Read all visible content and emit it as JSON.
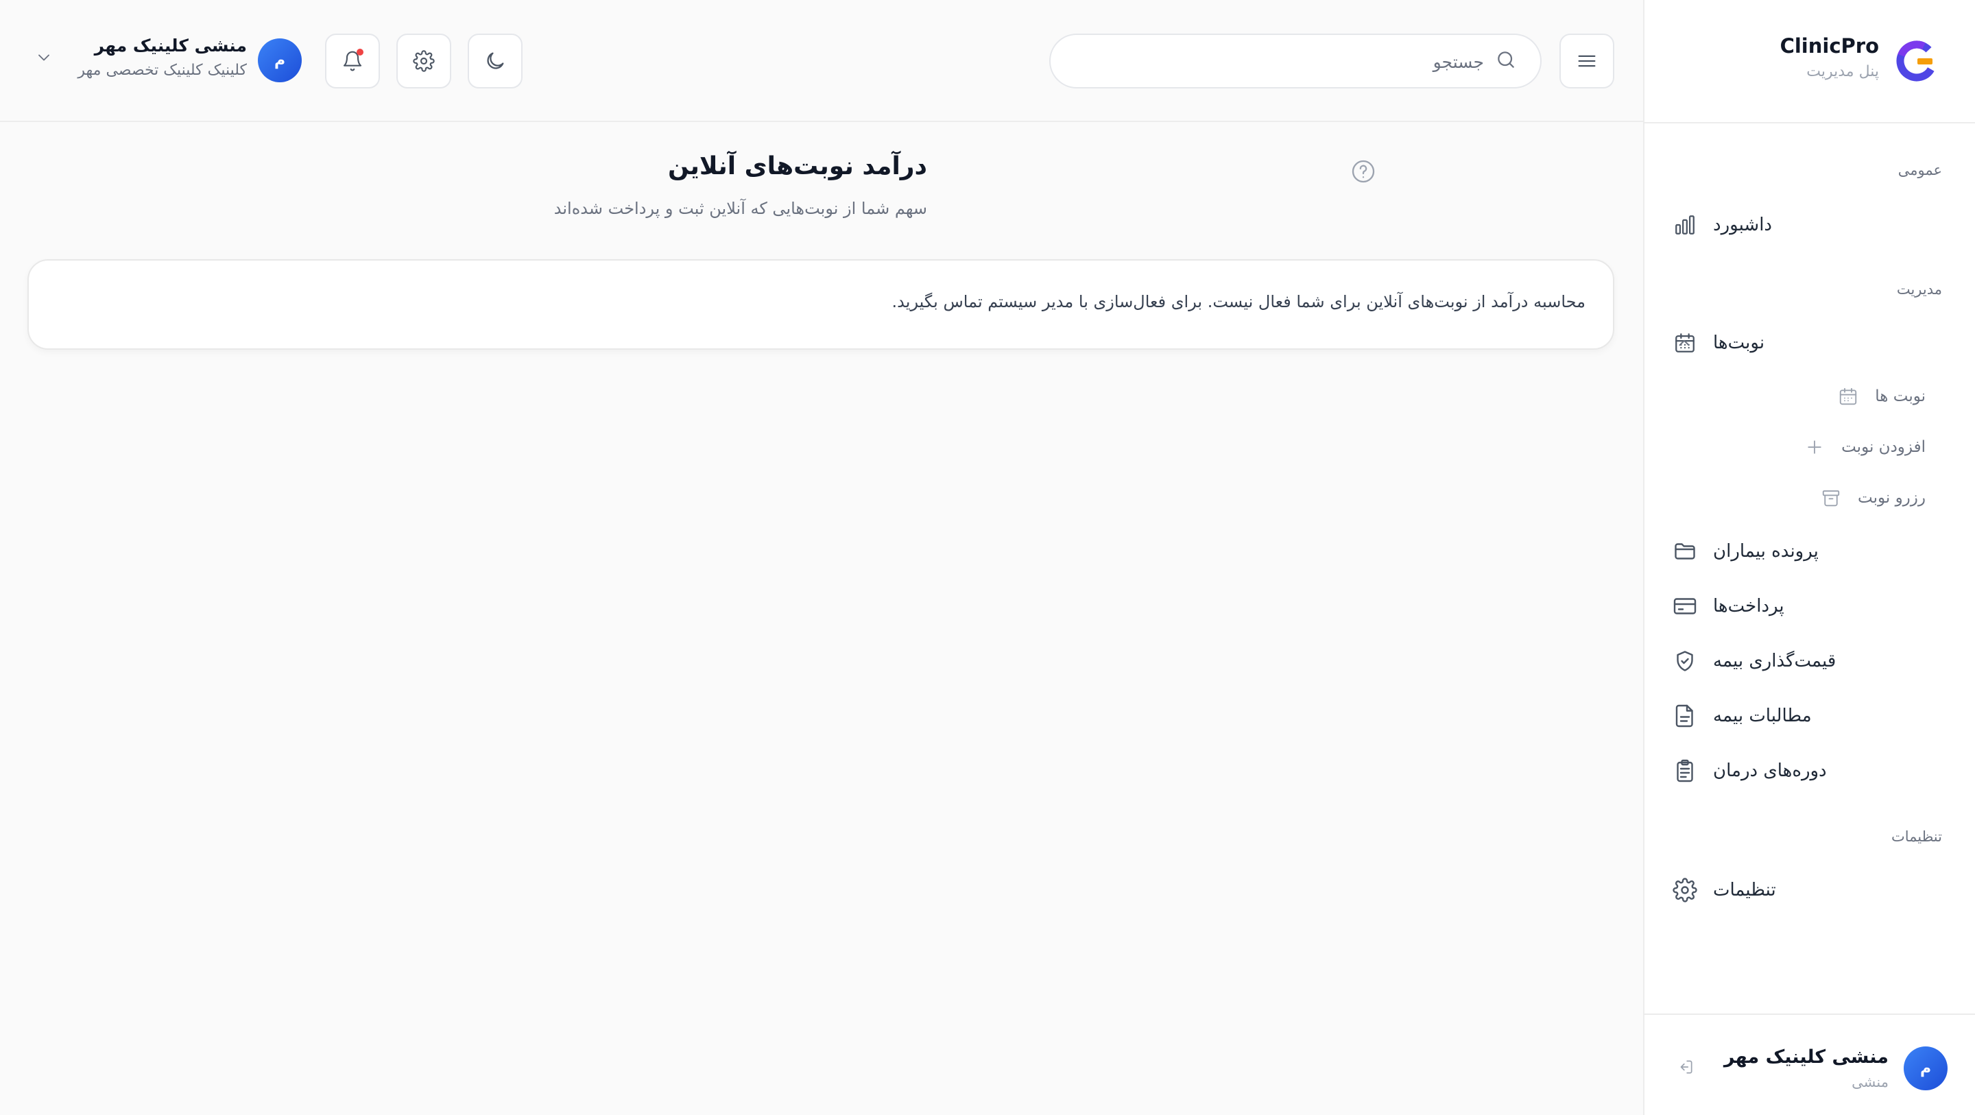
{
  "brand": {
    "title": "ClinicPro",
    "subtitle": "پنل مدیریت",
    "logo_icon": "clinicpro-logo-icon"
  },
  "sidebar": {
    "sections": {
      "general": "عمومی",
      "management": "مدیریت",
      "settings": "تنظیمات"
    },
    "items": {
      "dashboard": {
        "label": "داشبورد",
        "icon": "bar-chart-icon"
      },
      "appointments": {
        "label": "نوبت‌ها",
        "icon": "calendar-icon",
        "expanded": true
      },
      "patients": {
        "label": "پرونده بیماران",
        "icon": "folder-icon"
      },
      "payments": {
        "label": "پرداخت‌ها",
        "icon": "credit-card-icon"
      },
      "insurance_pricing": {
        "label": "قیمت‌گذاری بیمه",
        "icon": "shield-check-icon"
      },
      "insurance_claims": {
        "label": "مطالبات بیمه",
        "icon": "document-icon"
      },
      "treatment_courses": {
        "label": "دوره‌های درمان",
        "icon": "clipboard-icon"
      },
      "settings": {
        "label": "تنظیمات",
        "icon": "gear-icon"
      }
    },
    "subitems": {
      "appointment_list": {
        "label": "نوبت ها",
        "icon": "calendar-icon"
      },
      "add_appointment": {
        "label": "افزودن نوبت",
        "icon": "plus-icon"
      },
      "reserve_appointment": {
        "label": "رزرو نوبت",
        "icon": "archive-icon"
      }
    },
    "footer": {
      "avatar_initial": "م",
      "name": "منشی کلینیک مهر",
      "role": "منشی"
    }
  },
  "topbar": {
    "search": {
      "placeholder": "جستجو",
      "value": ""
    },
    "user": {
      "avatar_initial": "م",
      "name": "منشی کلینیک مهر",
      "clinic": "کلینیک کلینیک تخصصی مهر"
    },
    "notifications": {
      "has_unread": true
    }
  },
  "page": {
    "title": "درآمد نوبت‌های آنلاین",
    "subtitle": "سهم شما از نوبت‌هایی که آنلاین ثبت و پرداخت شده‌اند",
    "alert": "محاسبه درآمد از نوبت‌های آنلاین برای شما فعال نیست. برای فعال‌سازی با مدیر سیستم تماس بگیرید."
  },
  "colors": {
    "accent": "#2563eb",
    "logo": "#4f46e5",
    "notification_dot": "#ef4444"
  }
}
